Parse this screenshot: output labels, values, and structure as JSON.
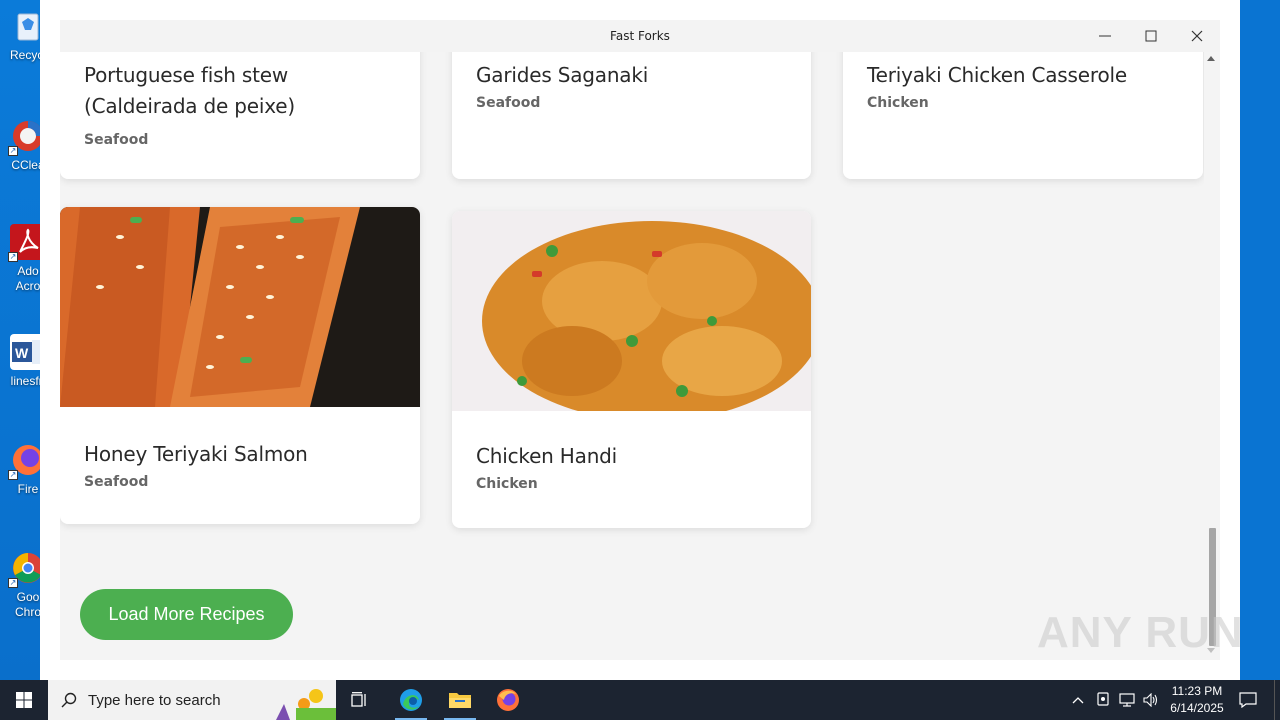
{
  "desktop": {
    "icons": [
      {
        "label": "Recycl",
        "name": "recycle-bin"
      },
      {
        "label": "CClea",
        "name": "ccleaner"
      },
      {
        "label": "Ado\nAcro",
        "name": "adobe-acrobat"
      },
      {
        "label": "linesfri",
        "name": "word-document"
      },
      {
        "label": "Fire",
        "name": "firefox"
      },
      {
        "label": "Goo\nChro",
        "name": "google-chrome"
      }
    ]
  },
  "window": {
    "title": "Fast Forks"
  },
  "recipes": [
    {
      "name": "Portuguese fish stew (Caldeirada de peixe)",
      "category": "Seafood"
    },
    {
      "name": "Garides Saganaki",
      "category": "Seafood"
    },
    {
      "name": "Teriyaki Chicken Casserole",
      "category": "Chicken"
    },
    {
      "name": "Honey Teriyaki Salmon",
      "category": "Seafood"
    },
    {
      "name": "Chicken Handi",
      "category": "Chicken"
    }
  ],
  "load_more_label": "Load More Recipes",
  "watermark": "ANY RUN",
  "taskbar": {
    "search_placeholder": "Type here to search",
    "time": "11:23 PM",
    "date": "6/14/2025"
  },
  "colors": {
    "accent": "#4caf50",
    "desktop": "#0a78d7",
    "taskbar": "#1c2431"
  }
}
